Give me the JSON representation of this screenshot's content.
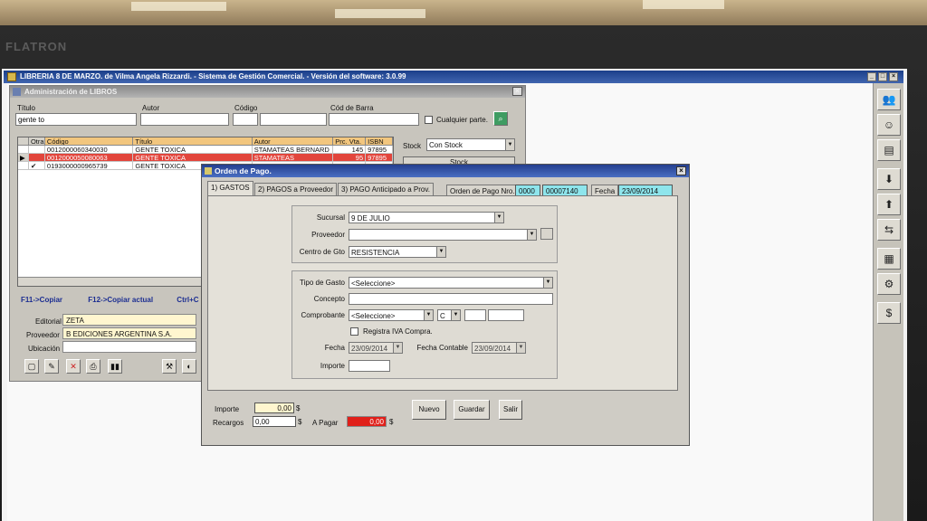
{
  "window": {
    "title": "LIBRERIA 8 DE MARZO. de Vilma Angela Rizzardi. - Sistema de Gestión Comercial. - Versión del software: 3.0.99",
    "brand": "FLATRON"
  },
  "libros": {
    "title": "Administración de LIBROS",
    "search": {
      "titulo_label": "Título",
      "titulo_value": "gente to",
      "autor_label": "Autor",
      "codigo_label": "Código",
      "cod_barra_label": "Cód de Barra",
      "cualquier_parte_label": "Cualquier parte."
    },
    "stock_label": "Stock",
    "stock_value": "Con Stock",
    "stock_button": "Stock",
    "grid": {
      "headers": [
        "Otra",
        "Código",
        "Título",
        "Autor",
        "Prc. Vta.",
        "ISBN"
      ],
      "rows": [
        {
          "marker": "",
          "check": "",
          "codigo": "0012000060340030",
          "titulo": "GENTE TOXICA",
          "autor": "STAMATEAS BERNARD",
          "precio": "145",
          "isbn": "97895"
        },
        {
          "marker": "▶",
          "check": "",
          "codigo": "0012000050080063",
          "titulo": "GENTE TOXICA",
          "autor": "STAMATEAS",
          "precio": "95",
          "isbn": "97895"
        },
        {
          "marker": "",
          "check": "✔",
          "codigo": "0193000000965739",
          "titulo": "GENTE TOXICA",
          "autor": "",
          "precio": "",
          "isbn": ""
        }
      ]
    },
    "shortcuts": {
      "copiar": "F11->Copiar",
      "copiar_actual": "F12->Copiar actual",
      "ctrl": "Ctrl+C"
    },
    "details": {
      "editorial_label": "Editorial",
      "editorial_value": "ZETA",
      "proveedor_label": "Proveedor",
      "proveedor_value": "B EDICIONES ARGENTINA S.A.",
      "ubicacion_label": "Ubicación",
      "ubicacion_value": ""
    }
  },
  "orden": {
    "title": "Orden de Pago.",
    "tabs": [
      "1) GASTOS",
      "2) PAGOS a Proveedor",
      "3) PAGO Anticipado a Prov."
    ],
    "nro_label": "Orden de Pago Nro.",
    "nro_prefix": "0000",
    "nro_value": "00007140",
    "fecha_label": "Fecha",
    "fecha_value": "23/09/2014",
    "sucursal_label": "Sucursal",
    "sucursal_value": "9 DE JULIO",
    "proveedor_label": "Proveedor",
    "proveedor_value": "",
    "centro_label": "Centro de Gto",
    "centro_value": "RESISTENCIA",
    "tipo_gasto_label": "Tipo de Gasto",
    "tipo_gasto_value": "<Seleccione>",
    "concepto_label": "Concepto",
    "concepto_value": "",
    "comprobante_label": "Comprobante",
    "comprobante_value": "<Seleccione>",
    "comprobante_letra": "C",
    "registra_iva_label": "Registra IVA Compra.",
    "fecha_comp_label": "Fecha",
    "fecha_comp_value": "23/09/2014",
    "fecha_contable_label": "Fecha Contable",
    "fecha_contable_value": "23/09/2014",
    "importe_label": "Importe",
    "importe_value": "",
    "totales": {
      "importe_label": "Importe",
      "importe_value": "0,00",
      "recargos_label": "Recargos",
      "recargos_value": "0,00",
      "a_pagar_label": "A Pagar",
      "a_pagar_value": "0,00",
      "currency": "$"
    },
    "buttons": {
      "nuevo": "Nuevo",
      "guardar": "Guardar",
      "salir": "Salir"
    }
  },
  "colors": {
    "title_bar": "#2b4f9c",
    "selected_row": "#e2453c",
    "highlight_field": "#8ee5ec",
    "a_pagar": "#e0201a"
  }
}
